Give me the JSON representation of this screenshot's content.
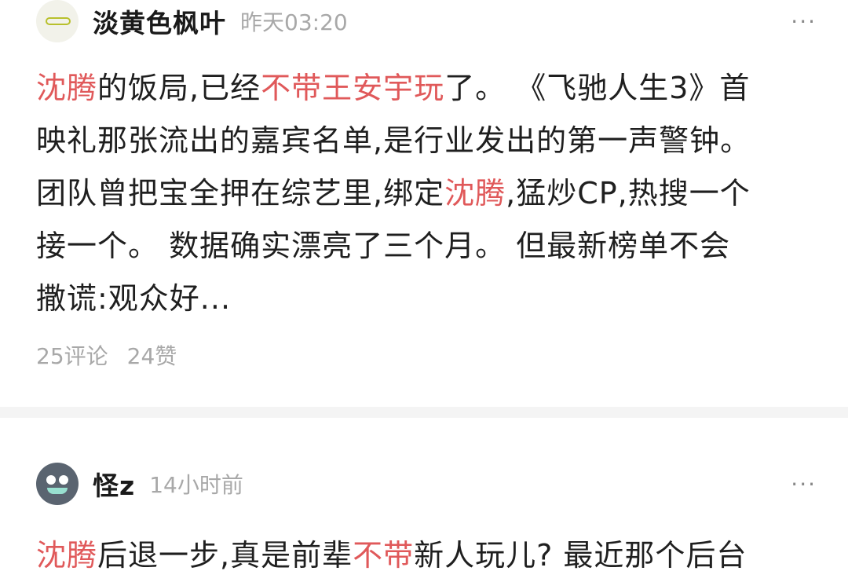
{
  "posts": [
    {
      "username": "淡黄色枫叶",
      "time": "昨天03:20",
      "more": "···",
      "lines": [
        [
          {
            "t": "沈腾",
            "hl": true
          },
          {
            "t": "的饭局,已经"
          },
          {
            "t": "不带王安宇玩",
            "hl": true
          },
          {
            "t": "了。 《飞驰人生3》首"
          }
        ],
        [
          {
            "t": "映礼那张流出的嘉宾名单,是行业发出的第一声警钟。"
          }
        ],
        [
          {
            "t": "团队曾把宝全押在综艺里,绑定"
          },
          {
            "t": "沈腾",
            "hl": true
          },
          {
            "t": ",猛炒CP,热搜一个"
          }
        ],
        [
          {
            "t": "接一个。 数据确实漂亮了三个月。 但最新榜单不会"
          }
        ],
        [
          {
            "t": "撒谎:观众好..."
          }
        ]
      ],
      "comments": "25评论",
      "likes": "24赞"
    },
    {
      "username": "怪z",
      "time": "14小时前",
      "more": "···",
      "lines": [
        [
          {
            "t": "沈腾",
            "hl": true
          },
          {
            "t": "后退一步,真是前辈"
          },
          {
            "t": "不带",
            "hl": true
          },
          {
            "t": "新人玩儿? 最近那个后台"
          }
        ]
      ]
    }
  ],
  "colors": {
    "highlight": "#e0595a",
    "muted": "#a8a8a8",
    "divider": "#f4f4f4"
  }
}
